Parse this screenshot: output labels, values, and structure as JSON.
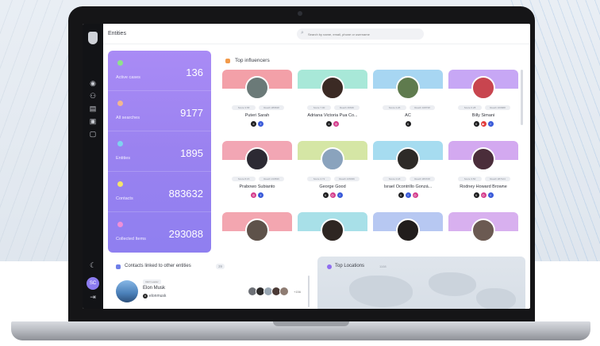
{
  "header": {
    "title": "Entities",
    "search_placeholder": "Search by name, email, phone or username"
  },
  "stats": [
    {
      "label": "Active cases",
      "value": "136",
      "color": "#8fe38b"
    },
    {
      "label": "All searches",
      "value": "9177",
      "color": "#f2b78f"
    },
    {
      "label": "Entities",
      "value": "1895",
      "color": "#7fd3f0"
    },
    {
      "label": "Contacts",
      "value": "883632",
      "color": "#f4e46a"
    },
    {
      "label": "Collected Items",
      "value": "293088",
      "color": "#f08fd8"
    }
  ],
  "influencers": {
    "title": "Top influencers",
    "cards": [
      {
        "name": "Puteri Sarah",
        "score": "Score 3.58",
        "reach": "Reach 289638",
        "banner": "#f3a0a8",
        "avatar": "#6b7a78",
        "socials": [
          "x",
          "facebook"
        ]
      },
      {
        "name": "Adriana Victoria Pua Co...",
        "score": "Score 7.00",
        "reach": "Reach 46636",
        "banner": "#a8e8d8",
        "avatar": "#3b2a24",
        "socials": [
          "x",
          "instagram"
        ]
      },
      {
        "name": "AC",
        "score": "Score 4.26",
        "reach": "Reach 108738",
        "banner": "#a7d6f2",
        "avatar": "#5f7b4e",
        "socials": [
          "x"
        ]
      },
      {
        "name": "Billy Simani",
        "score": "Score 6.28",
        "reach": "Reach 166688",
        "banner": "#c7a7f5",
        "avatar": "#c8454f",
        "socials": [
          "x",
          "youtube",
          "facebook"
        ]
      },
      {
        "name": "Prabowo Subianto",
        "score": "Score 8.15",
        "reach": "Reach 219536",
        "banner": "#f2a6b4",
        "avatar": "#2c2a33",
        "socials": [
          "instagram",
          "facebook"
        ]
      },
      {
        "name": "George Good",
        "score": "Score 4.72",
        "reach": "Reach 215036",
        "banner": "#d5e6a5",
        "avatar": "#8aa3bd",
        "socials": [
          "x",
          "instagram",
          "facebook"
        ]
      },
      {
        "name": "Israel Ocontrillo Gonzá...",
        "score": "Score 4.18",
        "reach": "Reach 283728",
        "banner": "#a6dcf0",
        "avatar": "#2d2a27",
        "socials": [
          "x",
          "facebook",
          "instagram"
        ]
      },
      {
        "name": "Rodney Howard Browne",
        "score": "Score 3.50",
        "reach": "Reach 287124",
        "banner": "#d3a9f0",
        "avatar": "#4a2d3a",
        "socials": [
          "x",
          "instagram",
          "facebook"
        ]
      },
      {
        "name": "",
        "score": "",
        "reach": "",
        "banner": "#f3a6b0",
        "avatar": "#5e524a",
        "socials": []
      },
      {
        "name": "",
        "score": "",
        "reach": "",
        "banner": "#a8e0e8",
        "avatar": "#2e2622",
        "socials": []
      },
      {
        "name": "",
        "score": "",
        "reach": "",
        "banner": "#b7c8f2",
        "avatar": "#211d1c",
        "socials": []
      },
      {
        "name": "",
        "score": "",
        "reach": "",
        "banner": "#d8b0ef",
        "avatar": "#6b5a52",
        "socials": []
      }
    ]
  },
  "contacts": {
    "title": "Contacts linked to other entities",
    "count": "39",
    "tag": "CEO Leader",
    "name": "Elon Musk",
    "handle": "elonmusk",
    "more": "+156"
  },
  "locations": {
    "title": "Top Locations",
    "count": "1108"
  },
  "user": {
    "initials": "SC"
  }
}
